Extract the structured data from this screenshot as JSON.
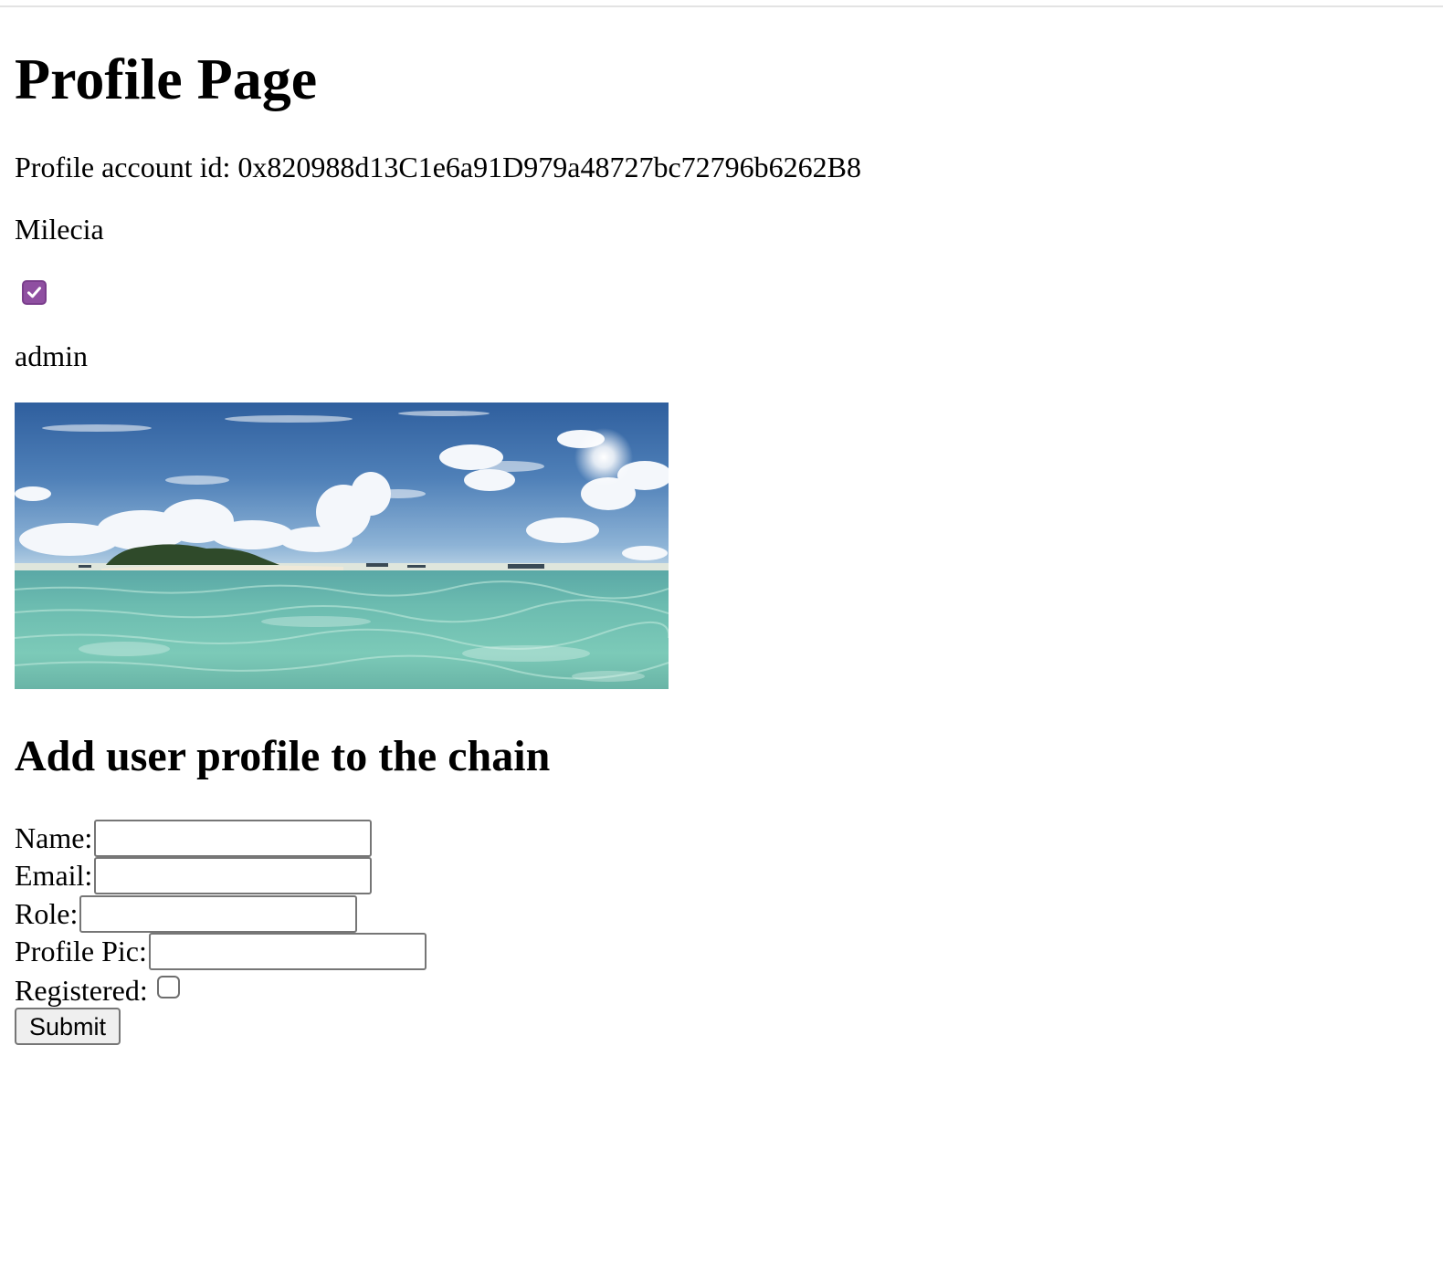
{
  "profile": {
    "title": "Profile Page",
    "account_id_label": "Profile account id: ",
    "account_id": "0x820988d13C1e6a91D979a48727bc72796b6262B8",
    "name": "Milecia",
    "registered": true,
    "role": "admin"
  },
  "form": {
    "title": "Add user profile to the chain",
    "name_label": "Name:",
    "name_value": "",
    "email_label": "Email:",
    "email_value": "",
    "role_label": "Role:",
    "role_value": "",
    "profile_pic_label": "Profile Pic:",
    "profile_pic_value": "",
    "registered_label": "Registered:",
    "registered_checked": false,
    "submit_label": "Submit"
  },
  "colors": {
    "checkbox_accent": "#8f4fa1",
    "page_background": "#ffffff"
  }
}
